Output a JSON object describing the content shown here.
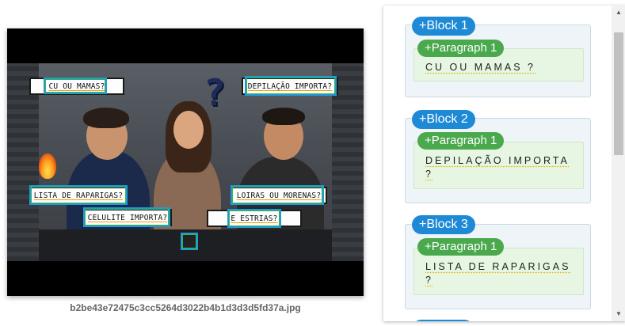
{
  "image": {
    "filename": "b2be43e72475c3cc5264d3022b4b1d3d3d5fd37a.jpg",
    "overlay_labels": [
      "CU OU MAMAS?",
      "DEPILAÇÃO IMPORTA?",
      "LISTA DE RAPARIGAS?",
      "CELULITE IMPORTA?",
      "LOIRAS OU MORENAS?",
      "E ESTRIAS?"
    ]
  },
  "blocks": [
    {
      "label": "+Block 1",
      "paragraph_label": "+Paragraph 1",
      "text": "CU OU MAMAS ?"
    },
    {
      "label": "+Block 2",
      "paragraph_label": "+Paragraph 1",
      "text": "DEPILAÇÃO IMPORTA ?"
    },
    {
      "label": "+Block 3",
      "paragraph_label": "+Paragraph 1",
      "text": "LISTA DE RAPARIGAS ?"
    }
  ],
  "scrollbar": {
    "up_icon": "up-arrow-icon",
    "down_icon": "down-arrow-icon"
  },
  "colors": {
    "block_badge": "#1e8ad6",
    "paragraph_badge": "#4aa84d",
    "detection_box": "#1e9bd7"
  }
}
